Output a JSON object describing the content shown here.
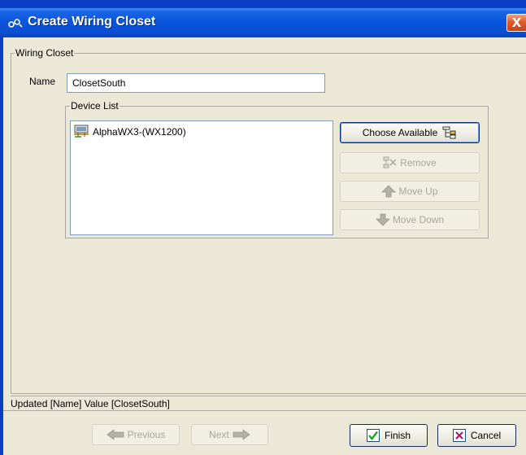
{
  "window": {
    "title": "Create Wiring Closet",
    "close_glyph": "X"
  },
  "wiring_closet": {
    "legend": "Wiring Closet",
    "name_label": "Name",
    "name_value": "ClosetSouth"
  },
  "device_list": {
    "legend": "Device List",
    "items": [
      {
        "label": "AlphaWX3-(WX1200)",
        "icon": "network-device-icon"
      }
    ]
  },
  "buttons": {
    "choose_available": "Choose Available",
    "remove": "Remove",
    "move_up": "Move Up",
    "move_down": "Move Down",
    "previous": "Previous",
    "next": "Next",
    "finish": "Finish",
    "cancel": "Cancel"
  },
  "status": {
    "message": "Updated [Name] Value [ClosetSouth]"
  },
  "colors": {
    "title_bar": "#0b55dc",
    "dialog_background": "#ebe8d8",
    "close_button": "#e35a2a",
    "disabled_text": "#a9a79c"
  }
}
